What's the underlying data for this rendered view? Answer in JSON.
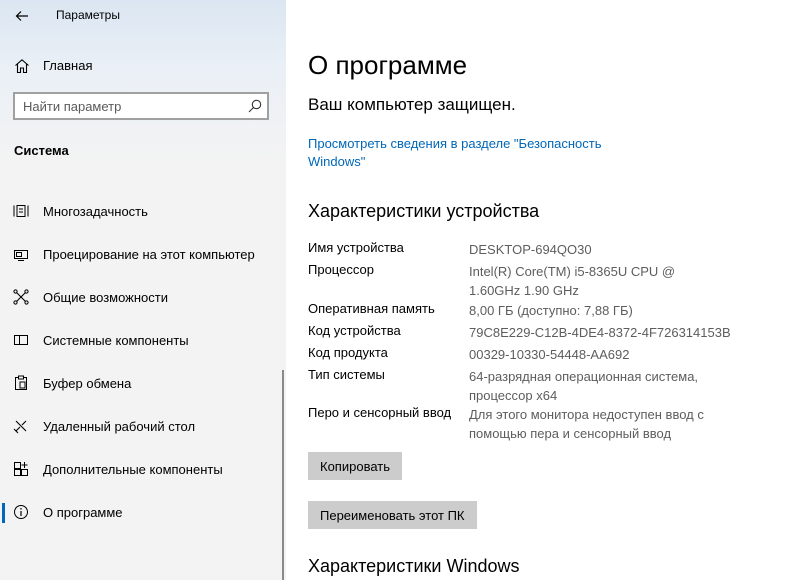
{
  "window": {
    "title": "Параметры"
  },
  "sidebar": {
    "home_label": "Главная",
    "search_placeholder": "Найти параметр",
    "section": "Система",
    "items": [
      {
        "label": "Многозадачность",
        "icon": "multitasking-icon"
      },
      {
        "label": "Проецирование на этот компьютер",
        "icon": "projecting-icon"
      },
      {
        "label": "Общие возможности",
        "icon": "shared-experiences-icon"
      },
      {
        "label": "Системные компоненты",
        "icon": "system-components-icon"
      },
      {
        "label": "Буфер обмена",
        "icon": "clipboard-icon"
      },
      {
        "label": "Удаленный рабочий стол",
        "icon": "remote-desktop-icon"
      },
      {
        "label": "Дополнительные компоненты",
        "icon": "optional-features-icon"
      },
      {
        "label": "О программе",
        "icon": "info-icon",
        "selected": true
      }
    ]
  },
  "main": {
    "title": "О программе",
    "status": "Ваш компьютер защищен.",
    "security_link": "Просмотреть сведения в разделе \"Безопасность Windows\"",
    "device_specs_heading": "Характеристики устройства",
    "specs": [
      {
        "label": "Имя устройства",
        "value": "DESKTOP-694QO30"
      },
      {
        "label": "Процессор",
        "value": "Intel(R) Core(TM) i5-8365U CPU @ 1.60GHz 1.90 GHz"
      },
      {
        "label": "Оперативная память",
        "value": "8,00 ГБ (доступно: 7,88 ГБ)"
      },
      {
        "label": "Код устройства",
        "value": "79C8E229-C12B-4DE4-8372-4F726314153B"
      },
      {
        "label": "Код продукта",
        "value": "00329-10330-54448-AA692"
      },
      {
        "label": "Тип системы",
        "value": "64-разрядная операционная система, процессор x64"
      },
      {
        "label": "Перо и сенсорный ввод",
        "value": "Для этого монитора недоступен ввод с помощью пера и сенсорный ввод"
      }
    ],
    "copy_button": "Копировать",
    "rename_button": "Переименовать этот ПК",
    "windows_specs_heading": "Характеристики Windows"
  },
  "colors": {
    "accent": "#0067c0",
    "link": "#0067b8",
    "button_bg": "#cccccc"
  }
}
